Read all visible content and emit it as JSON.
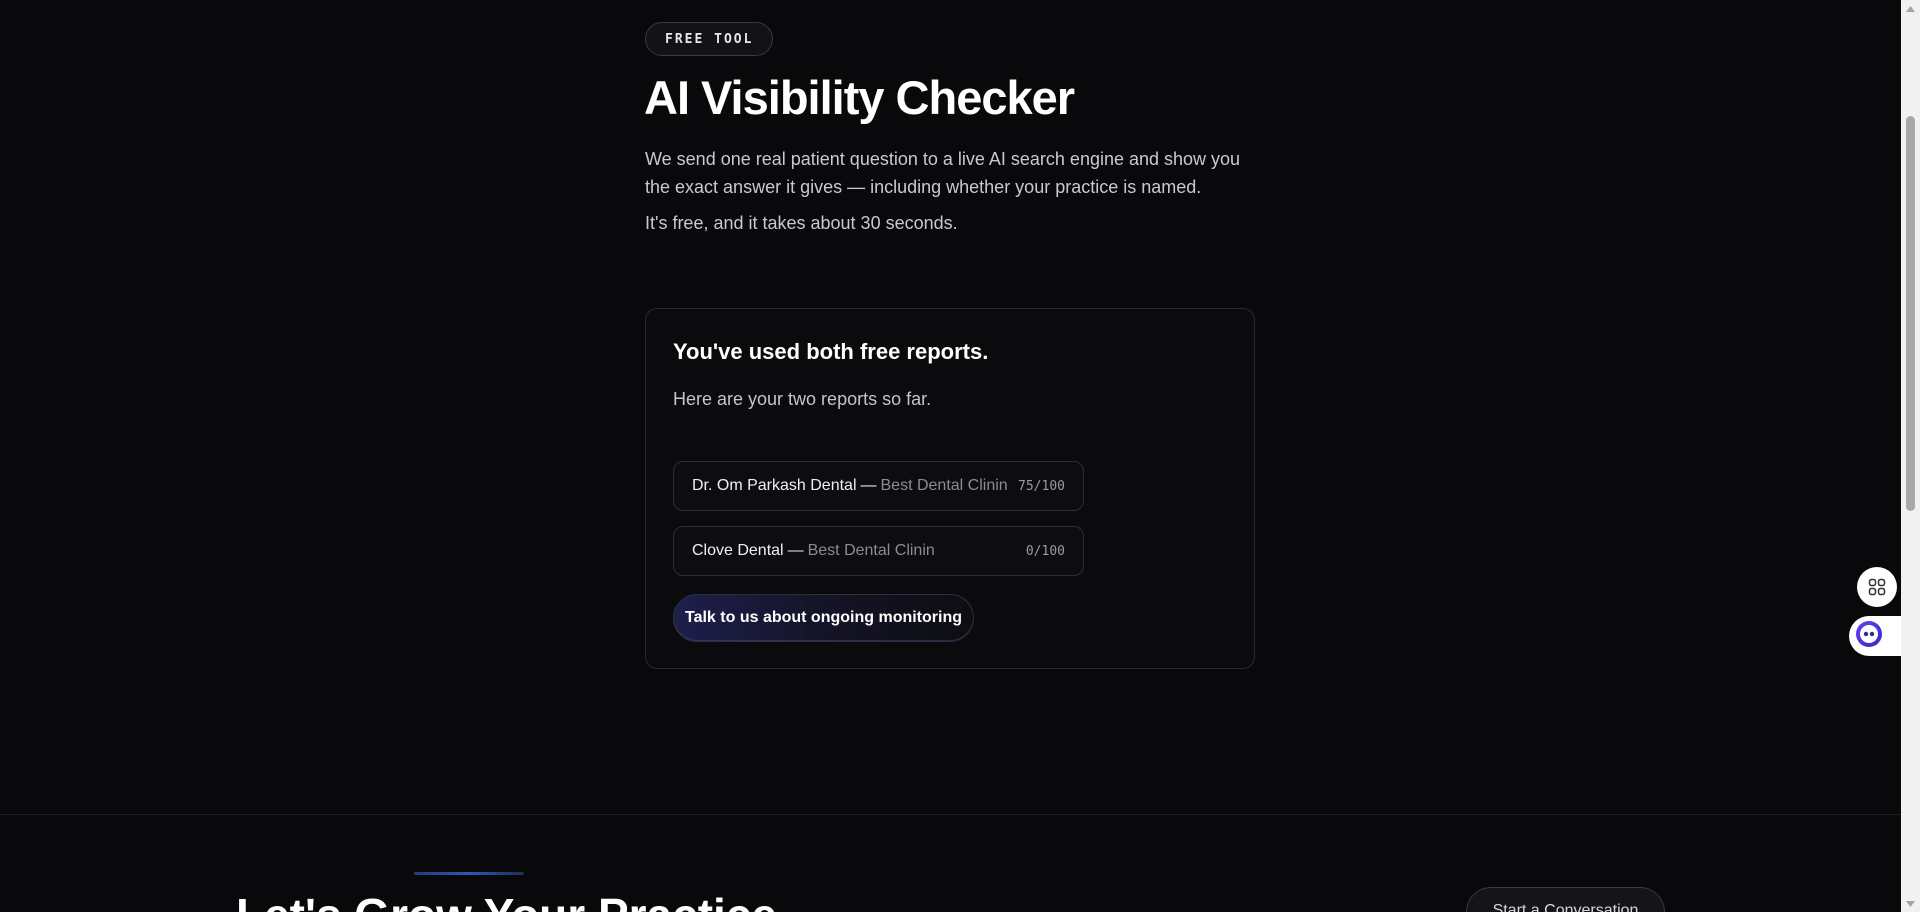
{
  "header": {
    "badge": "FREE TOOL",
    "title": "AI Visibility Checker",
    "description": "We send one real patient question to a live AI search engine and show you the exact answer it gives — including whether your practice is named.",
    "note": "It's free, and it takes about 30 seconds."
  },
  "card": {
    "heading": "You've used both free reports.",
    "subtext": "Here are your two reports so far.",
    "reports": [
      {
        "name": "Dr. Om Parkash Dental",
        "separator": "—",
        "query": "Best Dental Clinin",
        "score": "75/100"
      },
      {
        "name": "Clove Dental",
        "separator": "—",
        "query": "Best Dental Clinin",
        "score": "0/100"
      }
    ],
    "cta_label": "Talk to us about ongoing monitoring"
  },
  "footer": {
    "title": "Let's Grow Your Practice",
    "button_label": "Start a Conversation"
  },
  "floating": {
    "grid_icon": "grid-icon",
    "chat_icon": "chat-bot-icon"
  },
  "colors": {
    "background": "#09090b",
    "accent": "#2f56b8",
    "card_border": "#2a2a2f"
  }
}
